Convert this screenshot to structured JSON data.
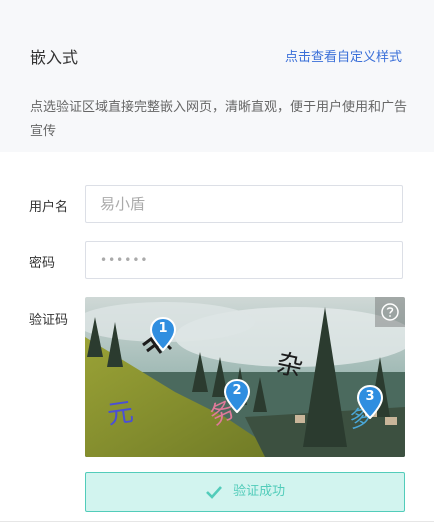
{
  "header": {
    "title": "嵌入式",
    "custom_link": "点击查看自定义样式",
    "description": "点选验证区域直接完整嵌入网页，清晰直观，便于用户使用和广告宣传"
  },
  "form": {
    "username": {
      "label": "用户名",
      "placeholder": "易小盾"
    },
    "password": {
      "label": "密码",
      "value": "••••••"
    },
    "captcha": {
      "label": "验证码",
      "help_icon": "question-circle-icon",
      "markers": [
        "1",
        "2",
        "3"
      ],
      "characters": [
        "元",
        "务",
        "杂",
        "多"
      ]
    }
  },
  "status": {
    "label": "验证成功",
    "icon": "check-icon",
    "color": "#52ccba",
    "background": "#d2f4ef"
  },
  "colors": {
    "link": "#3a6fd8",
    "marker": "#2f8ee0"
  }
}
